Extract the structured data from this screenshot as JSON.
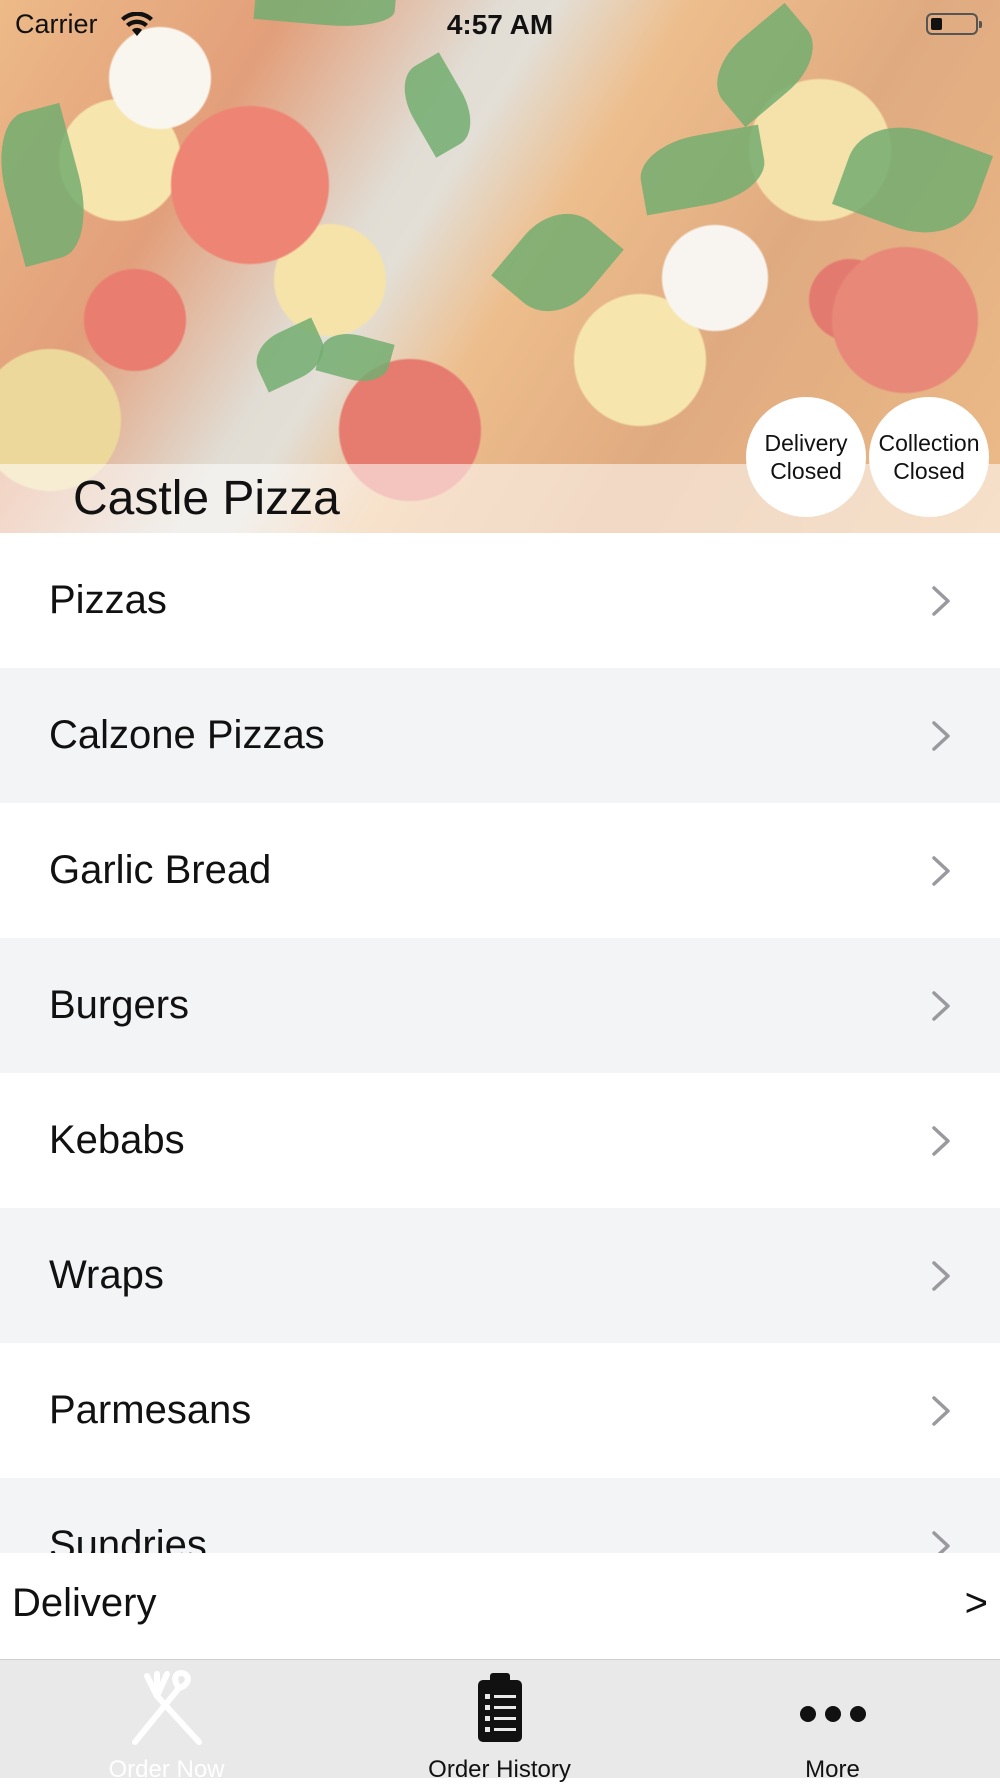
{
  "status_bar": {
    "carrier": "Carrier",
    "time": "4:57 AM"
  },
  "restaurant": {
    "name": "Castle Pizza"
  },
  "status": {
    "delivery": {
      "line1": "Delivery",
      "line2": "Closed"
    },
    "collection": {
      "line1": "Collection",
      "line2": "Closed"
    }
  },
  "menu": {
    "categories": [
      {
        "label": "Pizzas"
      },
      {
        "label": "Calzone Pizzas"
      },
      {
        "label": "Garlic Bread"
      },
      {
        "label": "Burgers"
      },
      {
        "label": "Kebabs"
      },
      {
        "label": "Wraps"
      },
      {
        "label": "Parmesans"
      },
      {
        "label": "Sundries"
      }
    ]
  },
  "delivery_bar": {
    "label": "Delivery",
    "arrow": ">"
  },
  "tabs": [
    {
      "label": "Order Now",
      "icon": "fork-knife-icon",
      "active": true
    },
    {
      "label": "Order History",
      "icon": "clipboard-list-icon",
      "active": false
    },
    {
      "label": "More",
      "icon": "more-dots-icon",
      "active": false
    }
  ]
}
